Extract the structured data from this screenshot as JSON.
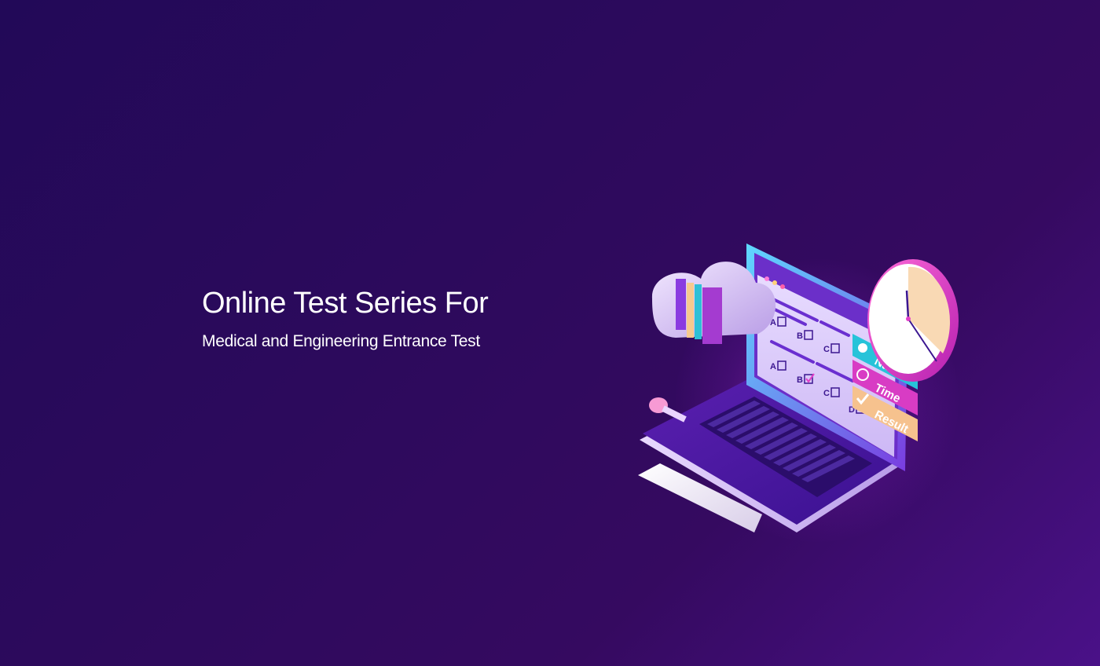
{
  "hero": {
    "title": "Online Test Series For",
    "subtitle": "Medical and Engineering Entrance Test"
  },
  "illustration": {
    "options_row1": [
      "A",
      "B",
      "C"
    ],
    "options_row2": [
      "A",
      "B",
      "C",
      "D"
    ],
    "panel_labels": {
      "name": "Name",
      "time": "Time",
      "result": "Result"
    },
    "icons": [
      "user-icon",
      "clock-icon",
      "checkmark-icon",
      "wall-clock-icon",
      "cloud-icon",
      "books-icon",
      "eraser-icon",
      "laptop-icon"
    ]
  },
  "colors": {
    "background_start": "#220958",
    "background_end": "#4a1188",
    "text": "#ffffff",
    "name_panel": "#27c3d9",
    "time_panel": "#d83cc4",
    "result_panel": "#f6c28e",
    "clock_rim": "#e33fc8",
    "accent_purple": "#7b2bd9"
  }
}
